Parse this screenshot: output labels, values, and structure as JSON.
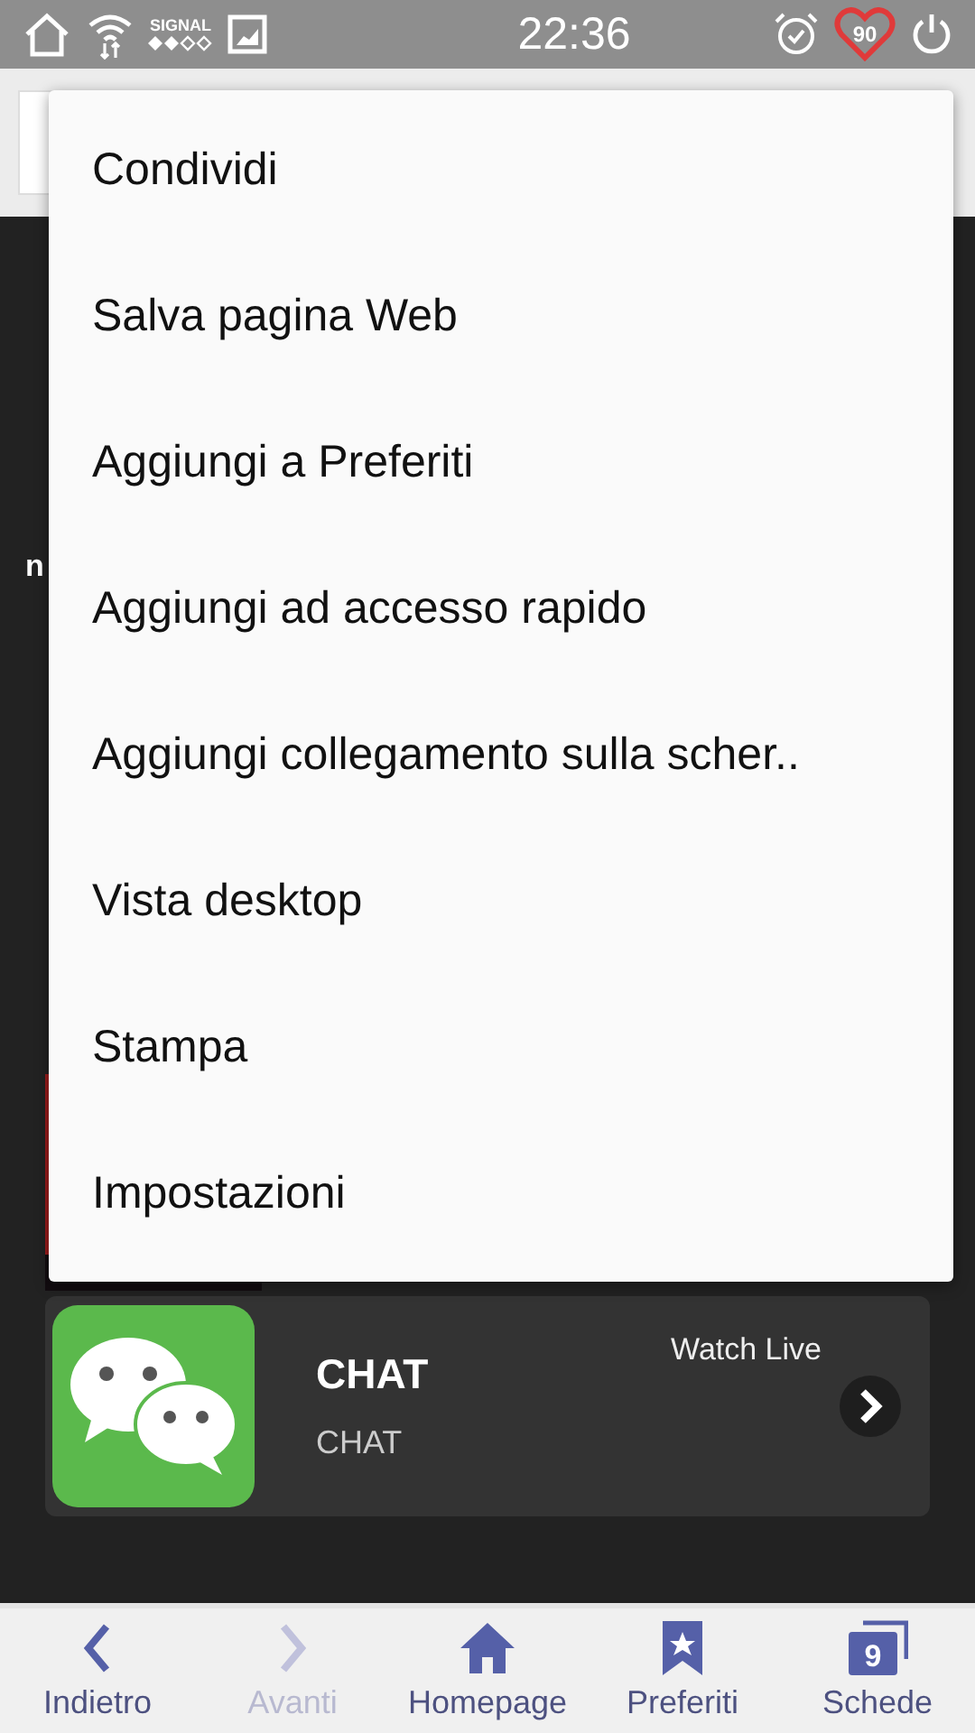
{
  "status_bar": {
    "signal_label": "SIGNAL",
    "time": "22:36",
    "battery_level_text": "90"
  },
  "page": {
    "heading_fragment": "n"
  },
  "menu": {
    "items": [
      {
        "label": "Condividi"
      },
      {
        "label": "Salva pagina Web"
      },
      {
        "label": "Aggiungi a Preferiti"
      },
      {
        "label": "Aggiungi ad accesso rapido"
      },
      {
        "label": "Aggiungi collegamento sulla scher.."
      },
      {
        "label": "Vista desktop"
      },
      {
        "label": "Stampa"
      },
      {
        "label": "Impostazioni"
      }
    ]
  },
  "card": {
    "title": "CHAT",
    "subtitle": "CHAT",
    "action": "Watch Live"
  },
  "bottom_nav": [
    {
      "label": "Indietro",
      "disabled": false
    },
    {
      "label": "Avanti",
      "disabled": true
    },
    {
      "label": "Homepage",
      "disabled": false
    },
    {
      "label": "Preferiti",
      "disabled": false
    },
    {
      "label": "Schede",
      "disabled": false,
      "count": "9"
    }
  ]
}
